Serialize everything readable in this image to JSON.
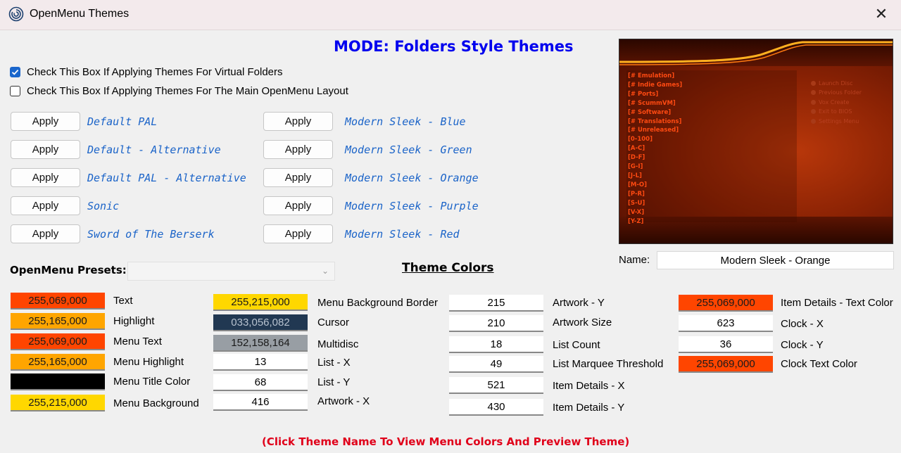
{
  "window": {
    "title": "OpenMenu Themes",
    "close_glyph": "✕"
  },
  "mode_title": "MODE: Folders Style Themes",
  "checkboxes": [
    {
      "label": "Check This Box If Applying Themes For Virtual Folders",
      "checked": true
    },
    {
      "label": "Check This Box If Applying Themes For The Main OpenMenu Layout",
      "checked": false
    }
  ],
  "apply_label": "Apply",
  "themes_left": [
    "Default PAL",
    "Default - Alternative",
    "Default PAL - Alternative",
    "Sonic",
    "Sword of The Berserk"
  ],
  "themes_right": [
    "Modern Sleek - Blue",
    "Modern Sleek - Green",
    "Modern Sleek - Orange",
    "Modern Sleek - Purple",
    "Modern Sleek - Red"
  ],
  "preview": {
    "folders": [
      "[# Emulation]",
      "[# Indie Games]",
      "[# Ports]",
      "[# ScummVM]",
      "[# Software]",
      "[# Translations]",
      "[# Unreleased]",
      "[0-100]",
      "[A-C]",
      "[D-F]",
      "[G-I]",
      "[J-L]",
      "[M-O]",
      "[P-R]",
      "[S-U]",
      "[V-X]",
      "[Y-Z]"
    ],
    "menu": [
      "Launch Disc",
      "Previous Folder",
      "Vox Create",
      "Exit to BIOS",
      "Settings Menu"
    ]
  },
  "name": {
    "label": "Name:",
    "value": "Modern Sleek - Orange"
  },
  "presets": {
    "label": "OpenMenu Presets:",
    "value": ""
  },
  "theme_colors_title": "Theme Colors",
  "col1": [
    {
      "value": "255,069,000",
      "label": "Text",
      "bg": "#ff4500"
    },
    {
      "value": "255,165,000",
      "label": "Highlight",
      "bg": "#ffa500"
    },
    {
      "value": "255,069,000",
      "label": "Menu Text",
      "bg": "#ff4500"
    },
    {
      "value": "255,165,000",
      "label": "Menu Highlight",
      "bg": "#ffa500"
    },
    {
      "value": "",
      "label": "Menu Title Color",
      "bg": "#000000"
    },
    {
      "value": "255,215,000",
      "label": "Menu Background",
      "bg": "#ffd700"
    }
  ],
  "col2": [
    {
      "value": "255,215,000",
      "label": "Menu Background Border",
      "bg": "#ffd700",
      "fg": "#1a1a1a"
    },
    {
      "value": "033,056,082",
      "label": "Cursor",
      "bg": "#213852",
      "fg": "#b7c2cf"
    },
    {
      "value": "152,158,164",
      "label": "Multidisc",
      "bg": "#989ea4",
      "fg": "#1a1a1a"
    },
    {
      "value": "13",
      "label": "List - X"
    },
    {
      "value": "68",
      "label": "List - Y"
    },
    {
      "value": "416",
      "label": "Artwork - X"
    }
  ],
  "col3": [
    {
      "value": "215",
      "label": "Artwork - Y"
    },
    {
      "value": "210",
      "label": "Artwork Size"
    },
    {
      "value": "18",
      "label": "List Count"
    },
    {
      "value": "49",
      "label": "List Marquee Threshold"
    },
    {
      "value": "521",
      "label": "Item Details - X"
    },
    {
      "value": "430",
      "label": "Item Details - Y"
    }
  ],
  "col4": [
    {
      "value": "255,069,000",
      "label": "Item Details - Text Color",
      "bg": "#ff4500"
    },
    {
      "value": "623",
      "label": "Clock - X"
    },
    {
      "value": "36",
      "label": "Clock - Y"
    },
    {
      "value": "255,069,000",
      "label": "Clock Text Color",
      "bg": "#ff4500"
    }
  ],
  "footer": "(Click Theme Name To View Menu Colors And Preview Theme)"
}
